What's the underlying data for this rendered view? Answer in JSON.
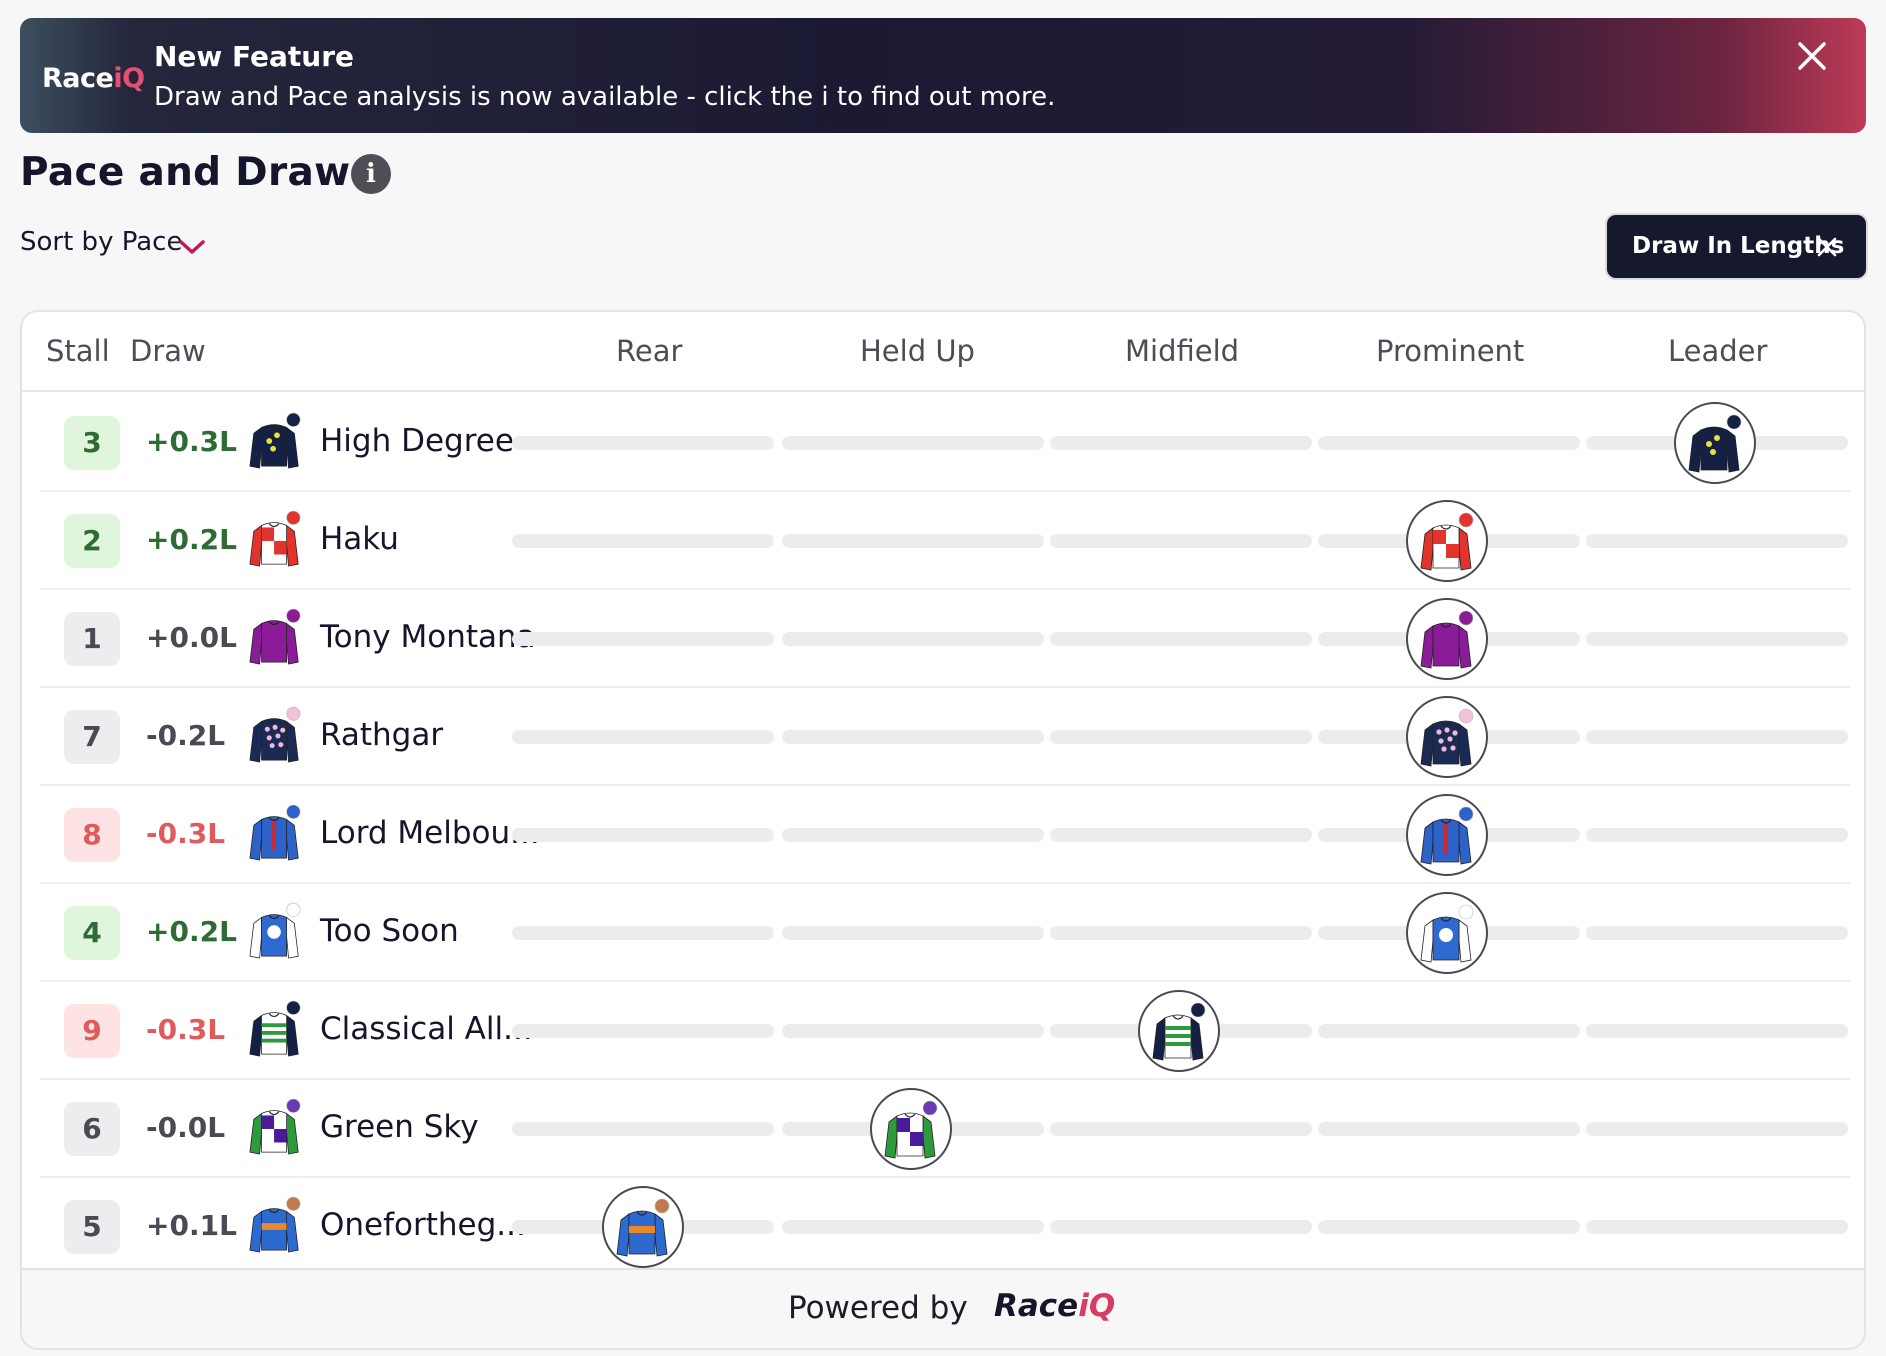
{
  "banner": {
    "logo": "Race",
    "logo_accent": "iQ",
    "title": "New Feature",
    "text": "Draw and Pace analysis is now available - click the i to find out more."
  },
  "header": {
    "title": "Pace and Draw",
    "info_glyph": "i",
    "sort_label": "Sort by Pace",
    "draw_button_label": "Draw In Lengths"
  },
  "table": {
    "columns": [
      "Stall",
      "Draw",
      "Rear",
      "Held Up",
      "Midfield",
      "Prominent",
      "Leader"
    ],
    "rows": [
      {
        "stall": "3",
        "draw": "+0.3L",
        "name": "High Degree",
        "pace": "Leader",
        "tone": "green",
        "silk": {
          "body": "#142044",
          "sleeve": "#142044",
          "pattern": "dots",
          "accent": "#e8e23a",
          "cap": "#142044"
        }
      },
      {
        "stall": "2",
        "draw": "+0.2L",
        "name": "Haku",
        "pace": "Prominent",
        "tone": "green",
        "silk": {
          "body": "#ffffff",
          "sleeve": "#e0342c",
          "pattern": "quarters",
          "accent": "#e0342c",
          "cap": "#e0342c"
        }
      },
      {
        "stall": "1",
        "draw": "+0.0L",
        "name": "Tony Montana",
        "pace": "Prominent",
        "tone": "neutral",
        "silk": {
          "body": "#8a1c98",
          "sleeve": "#8a1c98",
          "pattern": "plain",
          "accent": "#8a1c98",
          "cap": "#8a1c98"
        }
      },
      {
        "stall": "7",
        "draw": "-0.2L",
        "name": "Rathgar",
        "pace": "Prominent",
        "tone": "neutral",
        "silk": {
          "body": "#1a2a55",
          "sleeve": "#1a2a55",
          "pattern": "spots",
          "accent": "#f2b9d6",
          "cap": "#f2c2da"
        }
      },
      {
        "stall": "8",
        "draw": "-0.3L",
        "name": "Lord Melbou...",
        "pace": "Prominent",
        "tone": "red",
        "silk": {
          "body": "#2d62c8",
          "sleeve": "#2d62c8",
          "pattern": "stripe",
          "accent": "#d6262c",
          "cap": "#2d62c8"
        }
      },
      {
        "stall": "4",
        "draw": "+0.2L",
        "name": "Too Soon",
        "pace": "Prominent",
        "tone": "green",
        "silk": {
          "body": "#2f6ad1",
          "sleeve": "#ffffff",
          "pattern": "hoop",
          "accent": "#ffffff",
          "cap": "#ffffff"
        }
      },
      {
        "stall": "9",
        "draw": "-0.3L",
        "name": "Classical All...",
        "pace": "Midfield",
        "tone": "red",
        "silk": {
          "body": "#ffffff",
          "sleeve": "#142044",
          "pattern": "hoops",
          "accent": "#2e9a3e",
          "cap": "#142044"
        }
      },
      {
        "stall": "6",
        "draw": "-0.0L",
        "name": "Green Sky",
        "pace": "Held Up",
        "tone": "neutral",
        "silk": {
          "body": "#ffffff",
          "sleeve": "#2e9a3e",
          "pattern": "quarters",
          "accent": "#4a1a9a",
          "cap": "#6a3ab0"
        }
      },
      {
        "stall": "5",
        "draw": "+0.1L",
        "name": "Onefortheg...",
        "pace": "Rear",
        "tone": "neutral",
        "silk": {
          "body": "#2d6ad0",
          "sleeve": "#2d6ad0",
          "pattern": "band",
          "accent": "#e88a2a",
          "cap": "#c07a50"
        }
      }
    ]
  },
  "footer": {
    "powered_by": "Powered by",
    "logo": "Race",
    "logo_accent": "iQ"
  },
  "colors": {
    "accent": "#c2185b",
    "green_text": "#2f6b34",
    "green_bg": "#dff5dc",
    "red_text": "#e05b5b",
    "red_bg": "#fde3e3",
    "neutral_text": "#4a4a55",
    "neutral_bg": "#ededf0",
    "button_bg": "#16182e"
  },
  "icons": {
    "close": "close-icon",
    "info": "info-icon",
    "chevron": "chevron-down-icon",
    "silk": "jockey-silk-icon"
  }
}
